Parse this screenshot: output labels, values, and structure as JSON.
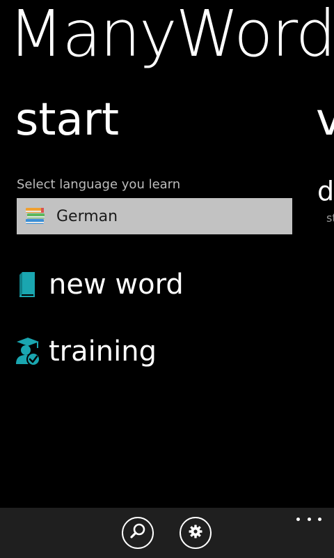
{
  "app": {
    "title": "ManyWords"
  },
  "pivot": {
    "current_header": "start",
    "next_header_peek": "v"
  },
  "language": {
    "label": "Select language you learn",
    "selected": "German",
    "icon": "books-icon"
  },
  "menu": {
    "items": [
      {
        "label": "new word",
        "icon": "book-icon"
      },
      {
        "label": "training",
        "icon": "graduate-check-icon"
      }
    ]
  },
  "peek": {
    "item": "d",
    "sub": "st"
  },
  "app_bar": {
    "buttons": [
      {
        "icon": "search-icon"
      },
      {
        "icon": "gear-icon"
      }
    ],
    "more_icon": "more-dots-icon"
  },
  "colors": {
    "background": "#000000",
    "accent": "#1aa6b0",
    "selector_background": "#c2c2c2",
    "app_bar": "#1f1f1f"
  }
}
